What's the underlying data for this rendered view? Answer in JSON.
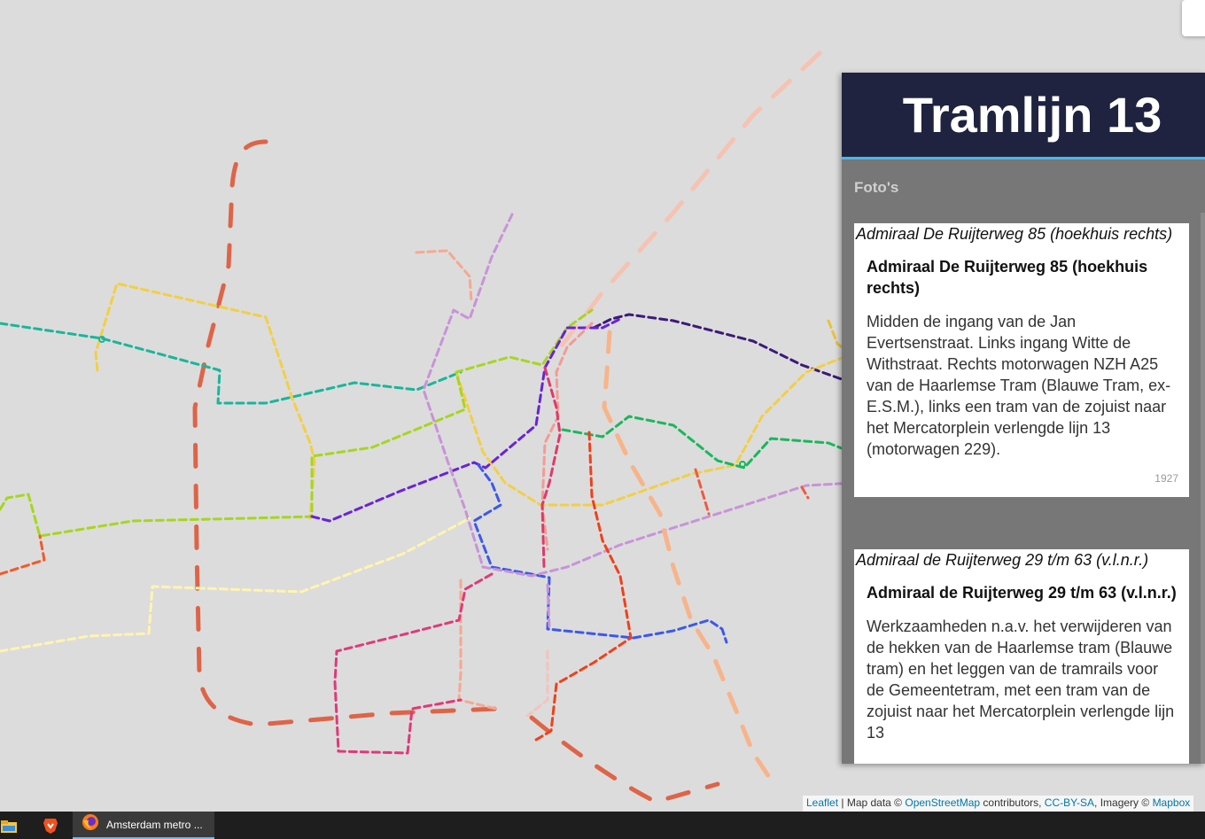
{
  "panel": {
    "title": "Tramlijn 13",
    "section_label": "Foto's",
    "photos": [
      {
        "caption": "Admiraal De Ruijterweg 85 (hoekhuis rechts)",
        "heading": "Admiraal De Ruijterweg 85 (hoekhuis rechts)",
        "description": "Midden de ingang van de Jan Evertsenstraat. Links ingang Witte de Withstraat. Rechts motorwagen NZH A25 van de Haarlemse Tram (Blauwe Tram, ex-E.S.M.), links een tram van de zojuist naar het Mercatorplein verlengde lijn 13 (motorwagen 229).",
        "year": "1927"
      },
      {
        "caption": "Admiraal de Ruijterweg 29 t/m 63 (v.l.n.r.)",
        "heading": "Admiraal de Ruijterweg 29 t/m 63 (v.l.n.r.)",
        "description": "Werkzaamheden n.a.v. het verwijderen van de hekken van de Haarlemse tram (Blauwe tram) en het leggen van de tramrails voor de Gemeentetram, met een tram van de zojuist naar het Mercatorplein verlengde lijn 13"
      }
    ]
  },
  "attribution": {
    "leaflet": "Leaflet",
    "separator": " | Map data © ",
    "osm": "OpenStreetMap",
    "contributors": " contributors, ",
    "license": "CC-BY-SA",
    "imagery": ", Imagery © ",
    "mapbox": "Mapbox"
  },
  "taskbar": {
    "app_label": "Amsterdam metro ...",
    "icons": [
      "file-explorer-icon",
      "brave-browser-icon",
      "firefox-icon"
    ]
  },
  "colors": {
    "map_background": "#dcdcdc",
    "panel_header": "#1f2340",
    "panel_accent": "#4db6e8",
    "panel_background": "#777777"
  }
}
